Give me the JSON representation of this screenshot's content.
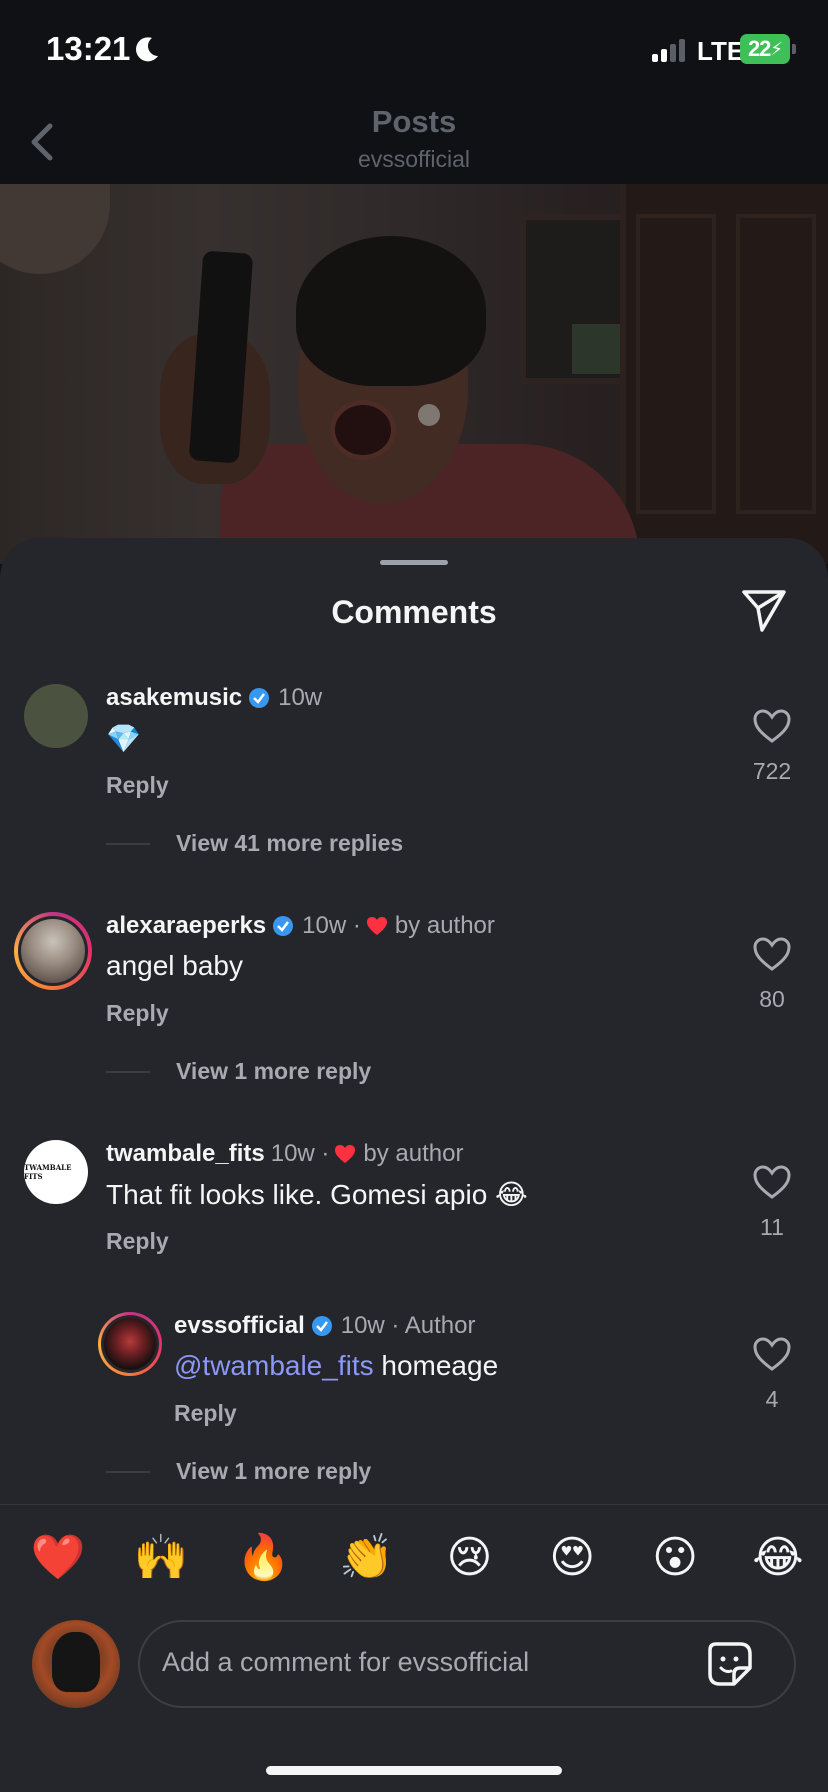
{
  "status_bar": {
    "time": "13:21",
    "network": "LTE",
    "battery": "22"
  },
  "nav": {
    "title": "Posts",
    "subtitle": "evssofficial"
  },
  "sheet": {
    "title": "Comments"
  },
  "comments": [
    {
      "username": "asakemusic",
      "verified": true,
      "time": "10w",
      "text": "💎",
      "reply_label": "Reply",
      "likes": "722",
      "view_more": "View 41 more replies"
    },
    {
      "username": "alexaraeperks",
      "verified": true,
      "time": "10w ·",
      "liked_by_author": "by author",
      "text": "angel baby",
      "reply_label": "Reply",
      "likes": "80",
      "view_more": "View 1 more reply"
    },
    {
      "username": "twambale_fits",
      "verified": false,
      "time": "10w ·",
      "liked_by_author": "by author",
      "text": "That fit looks like. Gomesi apio 😂",
      "reply_label": "Reply",
      "likes": "11",
      "avatar_text": "TWAMBALE FITS"
    },
    {
      "username": "evssofficial",
      "verified": true,
      "time": "10w · Author",
      "mention": "@twambale_fits",
      "text": " homeage",
      "reply_label": "Reply",
      "likes": "4",
      "view_more": "View 1 more reply"
    }
  ],
  "reactions": [
    "❤️",
    "🙌",
    "🔥",
    "👏",
    "😢",
    "😍",
    "😮",
    "😂"
  ],
  "composer": {
    "placeholder": "Add a comment for evssofficial"
  },
  "colors": {
    "background": "#24262b",
    "verified": "#3897f0",
    "heart": "#ff3040",
    "mention": "#8c98f5",
    "battery": "#3fbf57"
  },
  "icons": {
    "back": "chevron-left-icon",
    "share": "paper-plane-icon",
    "like": "heart-outline-icon",
    "sticker": "sticker-icon"
  }
}
